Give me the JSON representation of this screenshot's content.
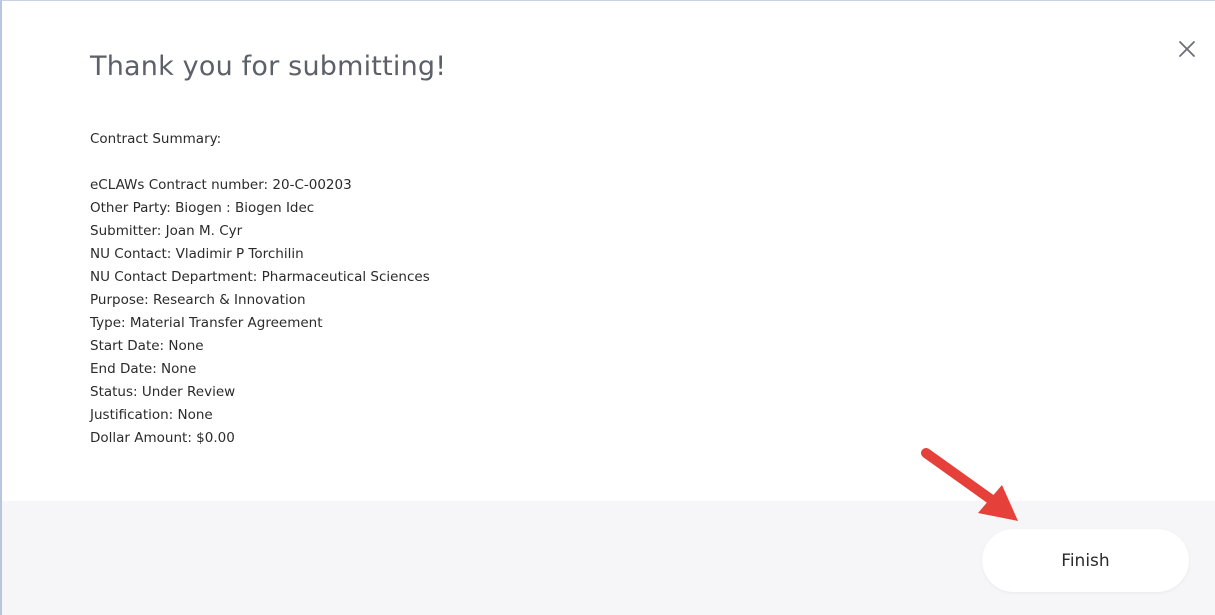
{
  "modal": {
    "title": "Thank you for submitting!",
    "summary_heading": "Contract Summary:",
    "summary_lines": [
      "eCLAWs Contract number: 20-C-00203",
      "Other Party: Biogen : Biogen Idec",
      "Submitter: Joan M. Cyr",
      "NU Contact: Vladimir P Torchilin",
      "NU Contact Department: Pharmaceutical Sciences",
      "Purpose: Research & Innovation",
      "Type: Material Transfer Agreement",
      "Start Date: None",
      "End Date: None",
      "Status: Under Review",
      "Justification: None",
      "Dollar Amount: $0.00"
    ],
    "finish_label": "Finish",
    "close_icon": "close-icon"
  },
  "annotation": {
    "arrow_icon": "arrow-icon",
    "arrow_color": "#e5403a"
  },
  "colors": {
    "title": "#5c6068",
    "text": "#2b2b2b",
    "footer_bg": "#f6f6f8",
    "button_bg": "#ffffff"
  }
}
